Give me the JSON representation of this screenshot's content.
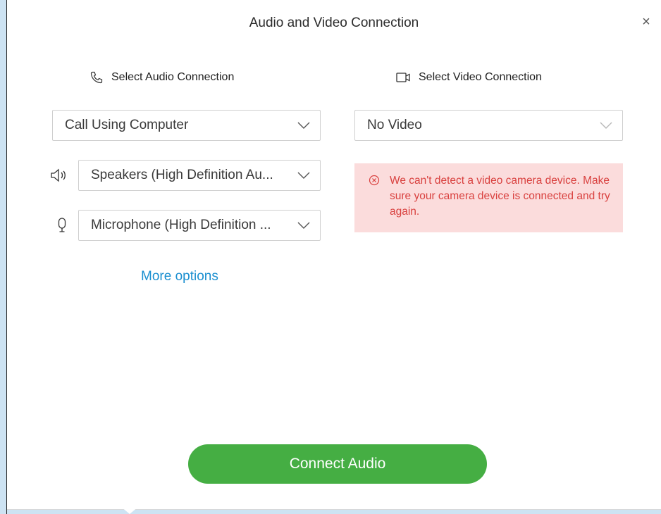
{
  "dialog": {
    "title": "Audio and Video Connection",
    "close_symbol": "×"
  },
  "audio": {
    "heading": "Select Audio Connection",
    "heading_icon": "phone-icon",
    "connection_value": "Call Using Computer",
    "speaker_value": "Speakers (High Definition Au...",
    "speaker_icon": "speaker-icon",
    "microphone_value": "Microphone (High Definition ...",
    "microphone_icon": "microphone-icon",
    "more_options_label": "More options"
  },
  "video": {
    "heading": "Select Video Connection",
    "heading_icon": "video-camera-icon",
    "connection_value": "No Video",
    "error_icon": "error-circle-icon",
    "error_message": "We can't detect a video camera device. Make sure your camera device is connected and try again."
  },
  "footer": {
    "connect_label": "Connect Audio"
  },
  "colors": {
    "primary_button": "#45ae43",
    "link": "#1a8fd0",
    "error_bg": "#fbdcdc",
    "error_text": "#d9413f",
    "window_frame": "#cde3f3"
  }
}
